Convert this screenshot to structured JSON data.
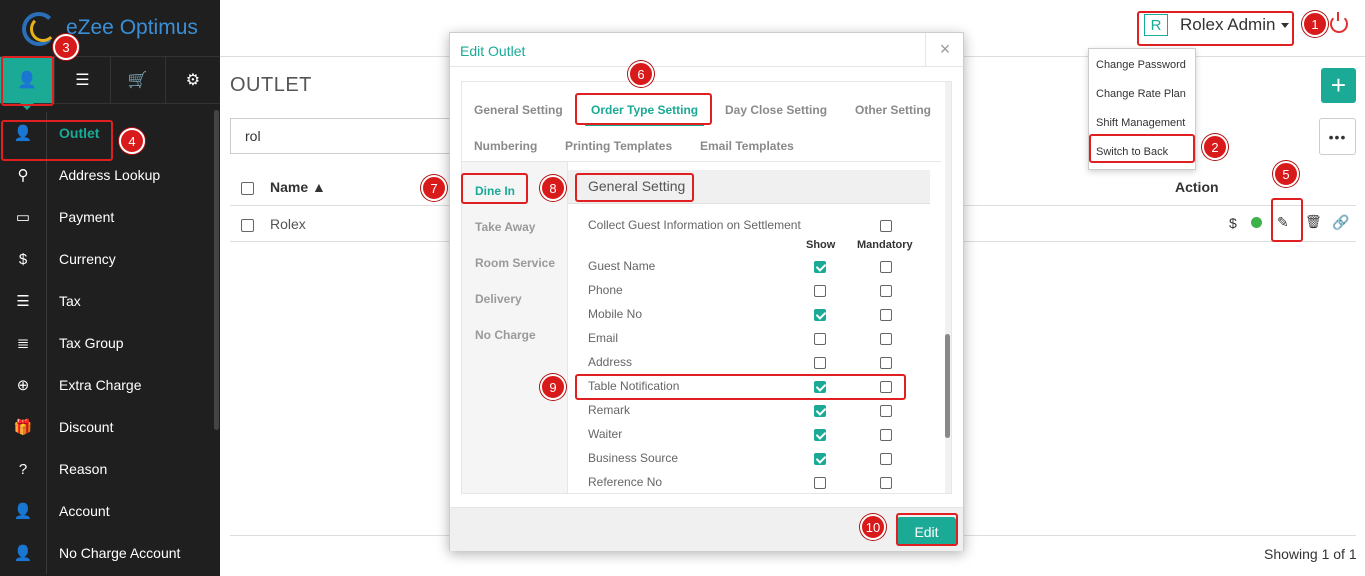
{
  "app": {
    "brand": "eZee Optimus"
  },
  "sidebar": {
    "top_tabs": [
      {
        "icon": "user-icon",
        "glyph": "👤"
      },
      {
        "icon": "menu-icon",
        "glyph": "☰"
      },
      {
        "icon": "cart-icon",
        "glyph": "🛒"
      },
      {
        "icon": "gear-icon",
        "glyph": "⚙"
      }
    ],
    "items": [
      {
        "label": "Outlet",
        "icon": "user-icon",
        "glyph": "👤",
        "active": true
      },
      {
        "label": "Address Lookup",
        "icon": "location-pin-icon",
        "glyph": "⚲"
      },
      {
        "label": "Payment",
        "icon": "credit-card-icon",
        "glyph": "▭"
      },
      {
        "label": "Currency",
        "icon": "dollar-icon",
        "glyph": "$"
      },
      {
        "label": "Tax",
        "icon": "bars-icon",
        "glyph": "☰"
      },
      {
        "label": "Tax Group",
        "icon": "list-icon",
        "glyph": "≣"
      },
      {
        "label": "Extra Charge",
        "icon": "plus-circle-icon",
        "glyph": "⊕"
      },
      {
        "label": "Discount",
        "icon": "gift-icon",
        "glyph": "🎁"
      },
      {
        "label": "Reason",
        "icon": "question-circle-icon",
        "glyph": "?"
      },
      {
        "label": "Account",
        "icon": "user-solid-icon",
        "glyph": "👤"
      },
      {
        "label": "No Charge Account",
        "icon": "user-solid-icon",
        "glyph": "👤"
      }
    ]
  },
  "header": {
    "avatar_letter": "R",
    "user_name": "Rolex Admin",
    "user_menu": [
      "Change Password",
      "Change Rate Plan",
      "Shift Management",
      "Switch to Back"
    ]
  },
  "main": {
    "title": "OUTLET",
    "add_label": "+",
    "more_label": "•••",
    "search_value": "rol",
    "columns": {
      "name": "Name ▲",
      "action": "Action"
    },
    "rows": [
      {
        "name": "Rolex",
        "status_color": "#3cb34a"
      }
    ],
    "action_dollar": "$",
    "showing": "Showing 1 of 1"
  },
  "modal": {
    "title": "Edit Outlet",
    "close": "×",
    "tabs": [
      "General Setting",
      "Order Type Setting",
      "Day Close Setting",
      "Other Setting",
      "Numbering",
      "Printing Templates",
      "Email Templates"
    ],
    "active_tab": "Order Type Setting",
    "order_types": [
      "Dine In",
      "Take Away",
      "Room Service",
      "Delivery",
      "No Charge"
    ],
    "section_title": "General Setting",
    "collect_label": "Collect Guest Information on Settlement",
    "col_show": "Show",
    "col_mandatory": "Mandatory",
    "fields": [
      {
        "label": "Guest Name",
        "show": true,
        "mandatory": false
      },
      {
        "label": "Phone",
        "show": false,
        "mandatory": false
      },
      {
        "label": "Mobile No",
        "show": true,
        "mandatory": false
      },
      {
        "label": "Email",
        "show": false,
        "mandatory": false
      },
      {
        "label": "Address",
        "show": false,
        "mandatory": false
      },
      {
        "label": "Table Notification",
        "show": true,
        "mandatory": false
      },
      {
        "label": "Remark",
        "show": true,
        "mandatory": false
      },
      {
        "label": "Waiter",
        "show": true,
        "mandatory": false
      },
      {
        "label": "Business Source",
        "show": true,
        "mandatory": false
      },
      {
        "label": "Reference No",
        "show": false,
        "mandatory": false
      }
    ],
    "edit_label": "Edit"
  },
  "annotations": [
    "1",
    "2",
    "3",
    "4",
    "5",
    "6",
    "7",
    "8",
    "9",
    "10"
  ],
  "colors": {
    "accent": "#1aaa96",
    "annotation": "#d81a1a",
    "sidebar": "#1f1f1f"
  }
}
